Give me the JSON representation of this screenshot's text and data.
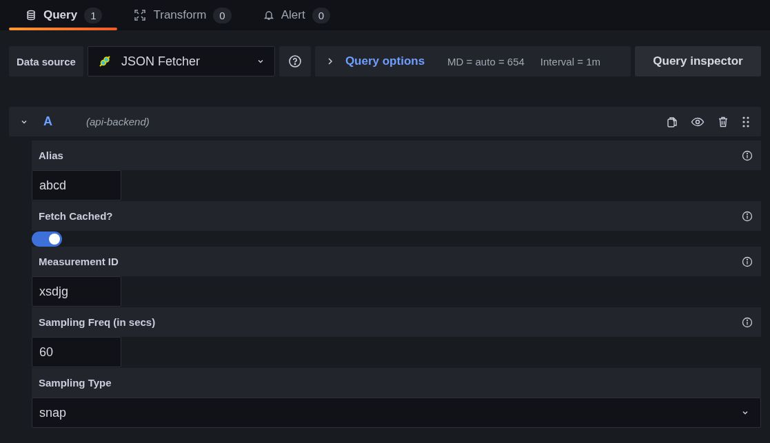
{
  "tabs": [
    {
      "label": "Query",
      "count": "1",
      "selected": true
    },
    {
      "label": "Transform",
      "count": "0",
      "selected": false
    },
    {
      "label": "Alert",
      "count": "0",
      "selected": false
    }
  ],
  "toolbar": {
    "data_source_label": "Data source",
    "data_source": "JSON Fetcher",
    "query_options": "Query options",
    "md": "MD = auto = 654",
    "interval": "Interval = 1m",
    "inspector": "Query inspector"
  },
  "query": {
    "ref": "A",
    "datasource": "(api-backend)",
    "expanded": true,
    "fields": [
      {
        "label": "Alias",
        "kind": "text",
        "value": "abcd",
        "info": true
      },
      {
        "label": "Fetch Cached?",
        "kind": "toggle",
        "on": true,
        "info": true
      },
      {
        "label": "Measurement ID",
        "kind": "text",
        "value": "xsdjg",
        "info": true
      },
      {
        "label": "Sampling Freq (in secs)",
        "kind": "text",
        "value": "60",
        "info": true
      },
      {
        "label": "Sampling Type",
        "kind": "select",
        "value": "snap",
        "info": false
      }
    ]
  }
}
